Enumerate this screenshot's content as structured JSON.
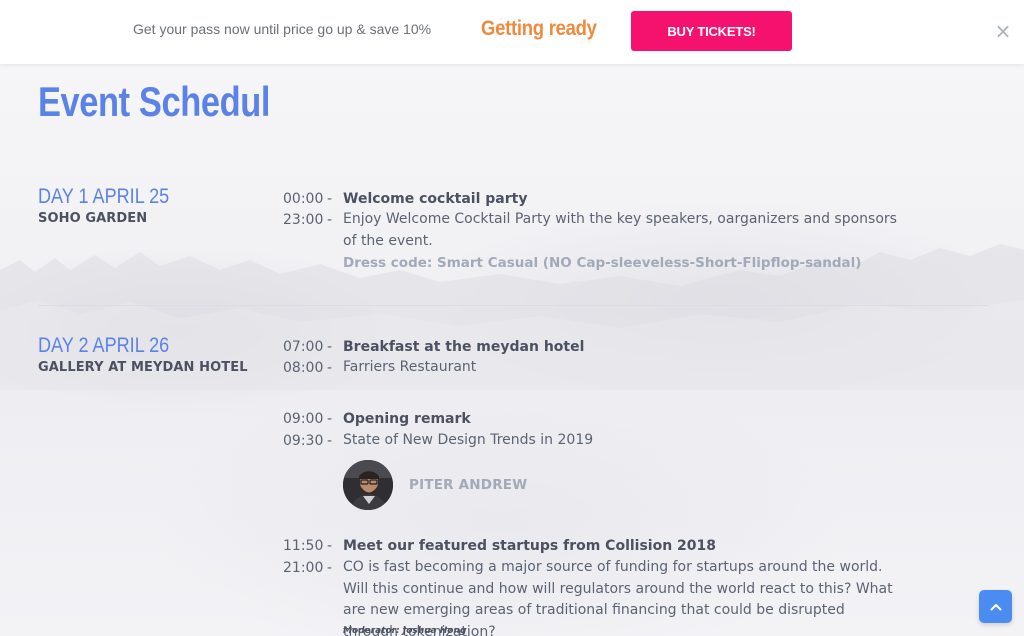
{
  "topbar": {
    "promo_text": "Get your pass now until price go up & save 10%",
    "status_text": "Getting ready",
    "buy_label": "BUY TICKETS!",
    "close_icon": "close-icon",
    "accent_color": "#f5126f",
    "status_color": "#ef8a3d"
  },
  "page": {
    "title": "Event Schedul",
    "title_color": "#5b82e6"
  },
  "days": [
    {
      "title": "DAY 1 APRIL 25",
      "venue": "SOHO GARDEN",
      "events": [
        {
          "start": "00:00",
          "end": "23:00",
          "title": "Welcome cocktail party",
          "description": "Enjoy Welcome Cocktail Party with the key speakers, oarganizers and sponsors of the event.",
          "dress_code": "Dress code: Smart Casual (NO Cap-sleeveless-Short-Flipflop-sandal)"
        }
      ]
    },
    {
      "title": "DAY 2 APRIL 26",
      "venue": "GALLERY AT MEYDAN HOTEL",
      "events": [
        {
          "start": "07:00",
          "end": "08:00",
          "title": "Breakfast at the meydan hotel",
          "description": "Farriers Restaurant"
        },
        {
          "start": "09:00",
          "end": "09:30",
          "title": "Opening remark",
          "description": "State of New Design Trends in 2019",
          "speaker": "PITER ANDREW"
        },
        {
          "start": "11:50",
          "end": "21:00",
          "title": "Meet our featured startups from Collision 2018",
          "description": "CO is fast becoming a major source of funding for startups around the world. Will this continue and how will regulators around the world react to this? What are new emerging areas of traditional financing that could be disrupted through tokenization?",
          "moderator": "Moderator: Joshua Hong"
        }
      ]
    }
  ],
  "dash": "-",
  "scroll_top_icon": "chevron-up-icon"
}
